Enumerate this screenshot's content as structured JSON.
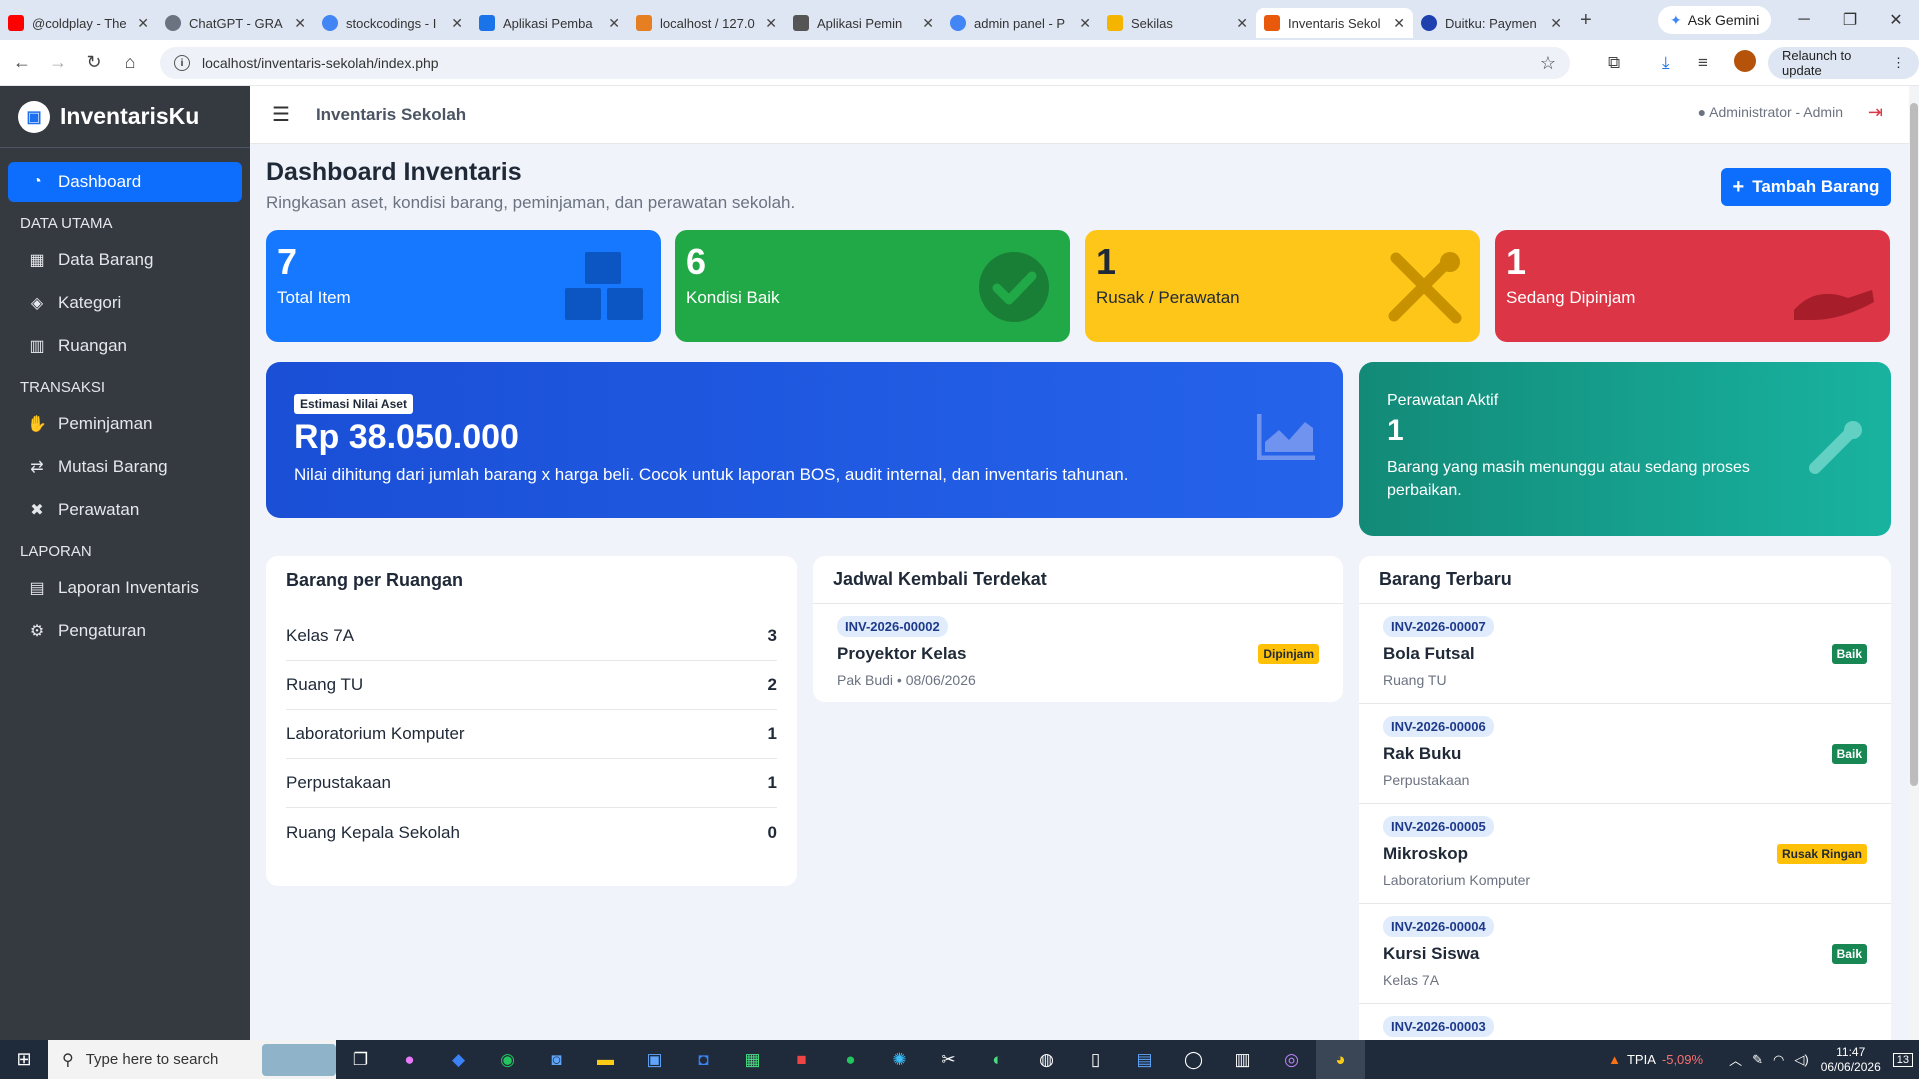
{
  "browser": {
    "tabs": [
      {
        "label": "@coldplay - The",
        "color": "#ff0000"
      },
      {
        "label": "ChatGPT - GRA",
        "color": "#6b7280"
      },
      {
        "label": "stockcodings - I",
        "color": "#4285f4"
      },
      {
        "label": "Aplikasi Pemba",
        "color": "#1a73e8"
      },
      {
        "label": "localhost / 127.0",
        "color": "#e67e22"
      },
      {
        "label": "Aplikasi Pemin",
        "color": "#555555"
      },
      {
        "label": "admin panel - P",
        "color": "#4285f4"
      },
      {
        "label": "Sekilas",
        "color": "#f4b400"
      },
      {
        "label": "Inventaris Sekol",
        "color": "#e8590c"
      },
      {
        "label": "Duitku: Paymen",
        "color": "#1e40af"
      }
    ],
    "new_tab": "+",
    "gemini_label": "Ask Gemini",
    "url": "localhost/inventaris-sekolah/index.php",
    "relaunch_label": "Relaunch to update"
  },
  "sidebar": {
    "brand": "InventarisKu",
    "dashboard": "Dashboard",
    "section_data": "DATA UTAMA",
    "data_barang": "Data Barang",
    "kategori": "Kategori",
    "ruangan": "Ruangan",
    "section_transaksi": "TRANSAKSI",
    "peminjaman": "Peminjaman",
    "mutasi": "Mutasi Barang",
    "perawatan": "Perawatan",
    "section_laporan": "LAPORAN",
    "laporan": "Laporan Inventaris",
    "pengaturan": "Pengaturan"
  },
  "topbar": {
    "title": "Inventaris Sekolah",
    "user": "Administrator - Admin"
  },
  "page": {
    "title": "Dashboard Inventaris",
    "subtitle": "Ringkasan aset, kondisi barang, peminjaman, dan perawatan sekolah.",
    "add_button": "Tambah Barang"
  },
  "stats": [
    {
      "value": "7",
      "label": "Total Item",
      "color": "#1677ff"
    },
    {
      "value": "6",
      "label": "Kondisi Baik",
      "color": "#22a947"
    },
    {
      "value": "1",
      "label": "Rusak / Perawatan",
      "color": "#ffc61a"
    },
    {
      "value": "1",
      "label": "Sedang Dipinjam",
      "color": "#dc3545"
    }
  ],
  "asset": {
    "pill": "Estimasi Nilai Aset",
    "value": "Rp 38.050.000",
    "desc": "Nilai dihitung dari jumlah barang x harga beli. Cocok untuk laporan BOS, audit internal, dan inventaris tahunan."
  },
  "maintenance": {
    "title": "Perawatan Aktif",
    "value": "1",
    "desc": "Barang yang masih menunggu atau sedang proses perbaikan."
  },
  "rooms": {
    "title": "Barang per Ruangan",
    "rows": [
      {
        "name": "Kelas 7A",
        "count": "3"
      },
      {
        "name": "Ruang TU",
        "count": "2"
      },
      {
        "name": "Laboratorium Komputer",
        "count": "1"
      },
      {
        "name": "Perpustakaan",
        "count": "1"
      },
      {
        "name": "Ruang Kepala Sekolah",
        "count": "0"
      }
    ]
  },
  "returns": {
    "title": "Jadwal Kembali Terdekat",
    "items": [
      {
        "code": "INV-2026-00002",
        "name": "Proyektor Kelas",
        "sub": "Pak Budi • 08/06/2026",
        "badge": "Dipinjam"
      }
    ]
  },
  "latest": {
    "title": "Barang Terbaru",
    "items": [
      {
        "code": "INV-2026-00007",
        "name": "Bola Futsal",
        "sub": "Ruang TU",
        "badge": "Baik"
      },
      {
        "code": "INV-2026-00006",
        "name": "Rak Buku",
        "sub": "Perpustakaan",
        "badge": "Baik"
      },
      {
        "code": "INV-2026-00005",
        "name": "Mikroskop",
        "sub": "Laboratorium Komputer",
        "badge": "Rusak Ringan"
      },
      {
        "code": "INV-2026-00004",
        "name": "Kursi Siswa",
        "sub": "Kelas 7A",
        "badge": "Baik"
      },
      {
        "code": "INV-2026-00003",
        "name": "",
        "sub": "",
        "badge": ""
      }
    ]
  },
  "taskbar": {
    "search_placeholder": "Type here to search",
    "stock_name": "TPIA",
    "stock_change": "-5,09%",
    "time": "11:47",
    "date": "06/06/2026",
    "notif_count": "13"
  }
}
